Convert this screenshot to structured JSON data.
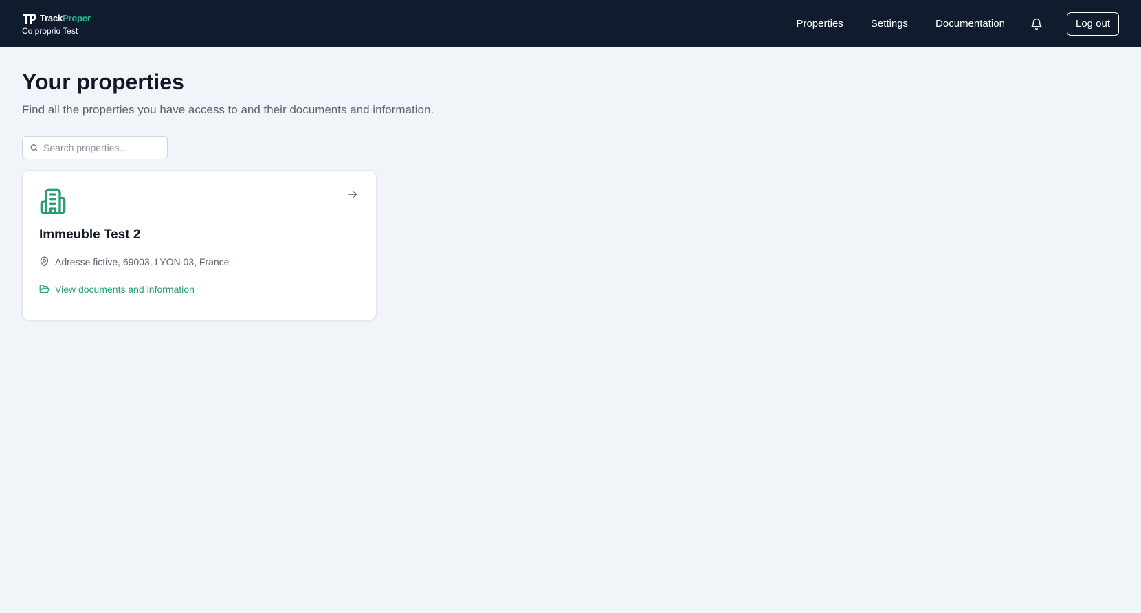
{
  "header": {
    "brand": {
      "name_part1": "Track",
      "name_part2": "Proper",
      "subtitle": "Co proprio Test"
    },
    "nav": [
      {
        "label": "Properties"
      },
      {
        "label": "Settings"
      },
      {
        "label": "Documentation"
      }
    ],
    "notifications_icon": "bell-icon",
    "logout_label": "Log out"
  },
  "main": {
    "title": "Your properties",
    "subtitle": "Find all the properties you have access to and their documents and information.",
    "search": {
      "placeholder": "Search properties...",
      "value": "",
      "icon": "search-icon"
    },
    "properties": [
      {
        "icon": "building-icon",
        "name": "Immeuble Test 2",
        "address": "Adresse fictive, 69003, LYON 03, France",
        "link_label": "View documents and information",
        "arrow_icon": "arrow-right-icon"
      }
    ]
  },
  "colors": {
    "header_bg": "#101b2d",
    "page_bg": "#f1f4f8",
    "accent": "#2a9d78",
    "brand_green": "#2fb58a"
  }
}
